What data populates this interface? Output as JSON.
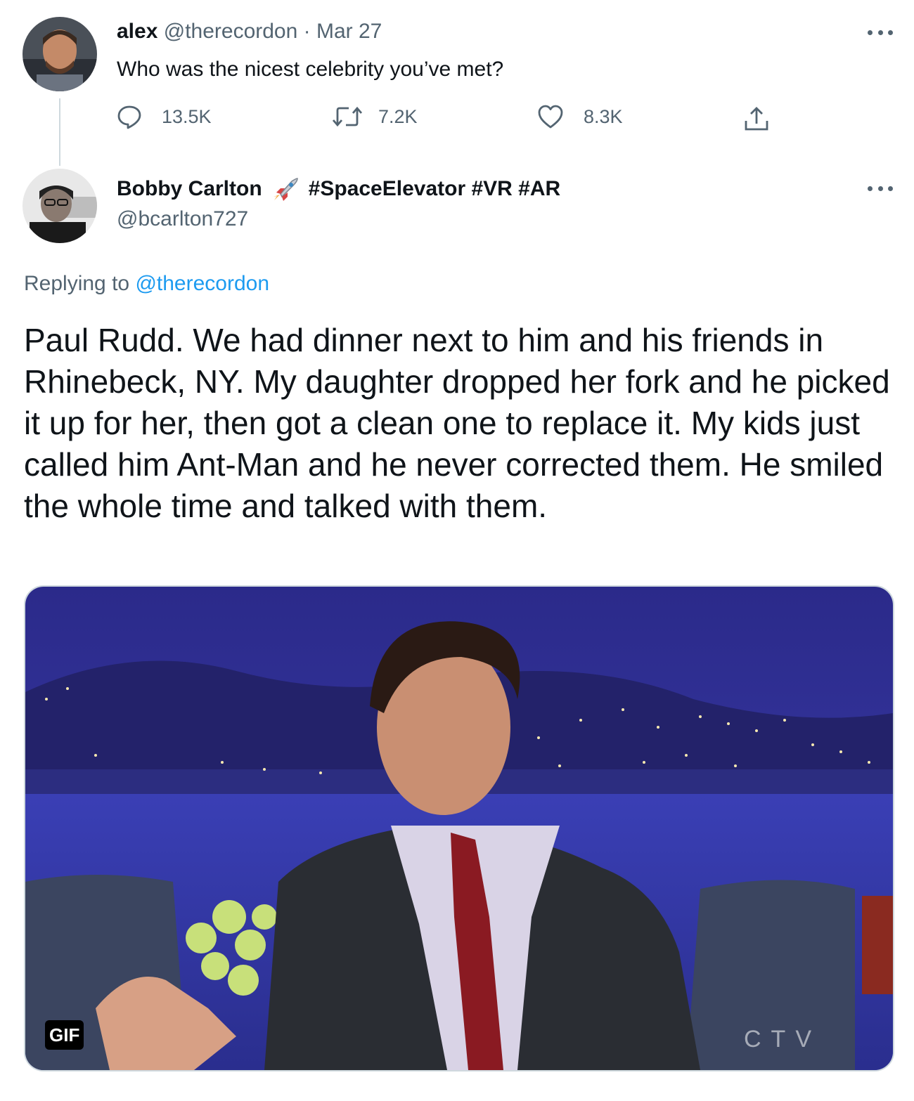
{
  "tweet1": {
    "display_name": "alex",
    "handle": "@therecordon",
    "separator": "·",
    "date": "Mar 27",
    "text": "Who was the nicest celebrity you’ve met?",
    "replies": "13.5K",
    "retweets": "7.2K",
    "likes": "8.3K",
    "icons": {
      "reply": "reply-icon",
      "retweet": "retweet-icon",
      "like": "heart-icon",
      "share": "share-icon",
      "more": "more-icon"
    }
  },
  "tweet2": {
    "display_name": "Bobby Carlton",
    "hashtags": "#SpaceElevator #VR #AR",
    "handle": "@bcarlton727",
    "replying_prefix": "Replying to",
    "replying_to": "@therecordon",
    "body": "Paul Rudd. We had dinner next to him and his friends in Rhinebeck, NY. My daughter dropped her fork and he picked it up for her, then got a clean one to replace it. My kids just called him Ant-Man and he never corrected them. He smiled the whole time and talked with them.",
    "media_badge": "GIF",
    "media_watermark": "CTV",
    "name_emoji": "rocket-emoji"
  },
  "colors": {
    "text": "#0f1419",
    "muted": "#536471",
    "link": "#1d9bf0",
    "border": "#cfd9de"
  }
}
